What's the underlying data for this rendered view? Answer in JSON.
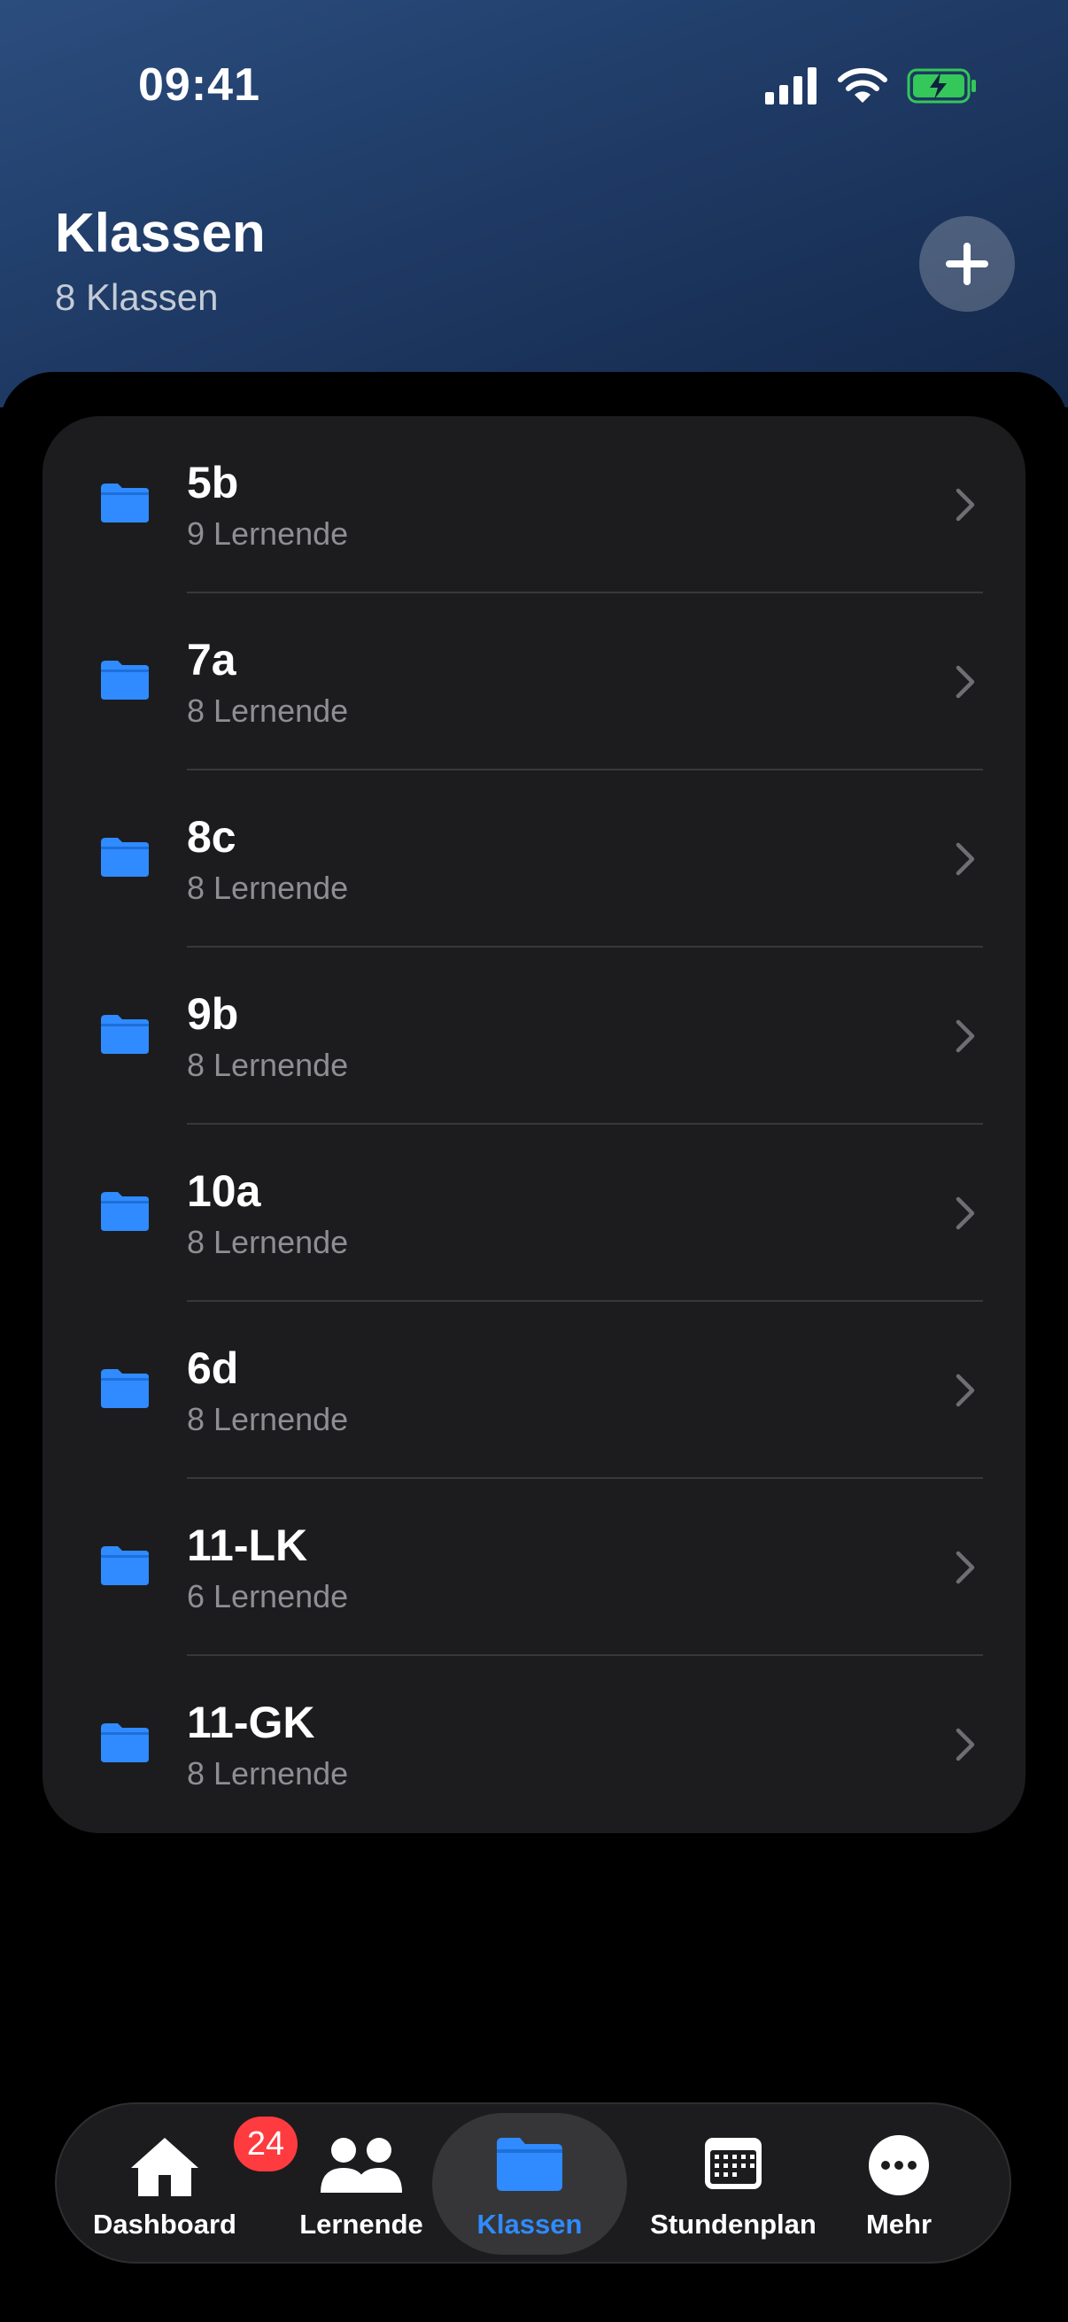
{
  "status_bar": {
    "time": "09:41"
  },
  "header": {
    "title": "Klassen",
    "subtitle": "8 Klassen"
  },
  "classes": [
    {
      "name": "5b",
      "students": "9 Lernende"
    },
    {
      "name": "7a",
      "students": "8 Lernende"
    },
    {
      "name": "8c",
      "students": "8 Lernende"
    },
    {
      "name": "9b",
      "students": "8 Lernende"
    },
    {
      "name": "10a",
      "students": "8 Lernende"
    },
    {
      "name": "6d",
      "students": "8 Lernende"
    },
    {
      "name": "11-LK",
      "students": "6 Lernende"
    },
    {
      "name": "11-GK",
      "students": "8 Lernende"
    }
  ],
  "tabs": [
    {
      "label": "Dashboard",
      "icon": "house-icon",
      "badge": "24"
    },
    {
      "label": "Lernende",
      "icon": "people-icon"
    },
    {
      "label": "Klassen",
      "icon": "folder-icon",
      "active": true
    },
    {
      "label": "Stundenplan",
      "icon": "calendar-icon"
    },
    {
      "label": "Mehr",
      "icon": "more-icon"
    }
  ],
  "colors": {
    "accent": "#2f8bff",
    "badge": "#ff3b3f",
    "battery": "#34c759",
    "card": "#1c1c1e",
    "header_top": "#2b4d7e",
    "header_bottom": "#14284a"
  }
}
